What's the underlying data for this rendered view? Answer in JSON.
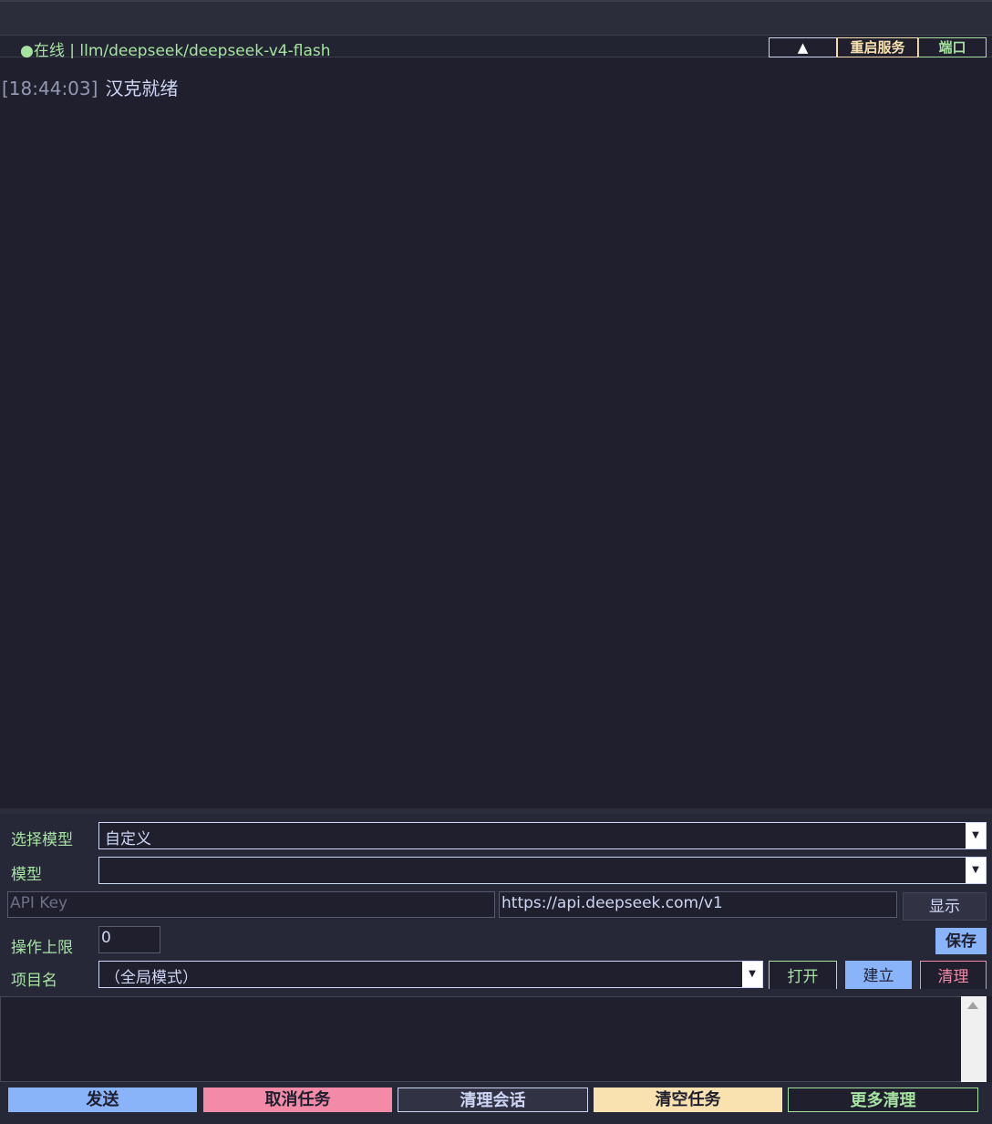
{
  "status": {
    "text": "●在线 | llm/deepseek/deepseek-v4-flash",
    "collapse_label": "▲",
    "restart_label": "重启服务",
    "port_label": "端口"
  },
  "log": {
    "entries": [
      {
        "time": "[18:44:03]",
        "message": "汉克就绪"
      }
    ]
  },
  "config": {
    "select_model_label": "选择模型",
    "select_model_value": "自定义",
    "model_label": "模型",
    "model_value": "",
    "api_key_placeholder": "API Key",
    "api_key_value": "",
    "base_url_value": "https://api.deepseek.com/v1",
    "show_label": "显示",
    "op_limit_label": "操作上限",
    "op_limit_value": "0",
    "save_label": "保存",
    "project_label": "项目名",
    "project_value": "（全局模式）",
    "open_label": "打开",
    "create_label": "建立",
    "clean_label": "清理"
  },
  "input": {
    "value": ""
  },
  "actions": {
    "send": "发送",
    "cancel_task": "取消任务",
    "clear_session": "清理会话",
    "clear_tasks": "清空任务",
    "more_clean": "更多清理"
  },
  "colors": {
    "background": "#1f1f2e",
    "accent_green": "#a6e3a1",
    "accent_blue": "#89b4fa",
    "accent_pink": "#f38ba8",
    "accent_yellow": "#f9e2af"
  }
}
